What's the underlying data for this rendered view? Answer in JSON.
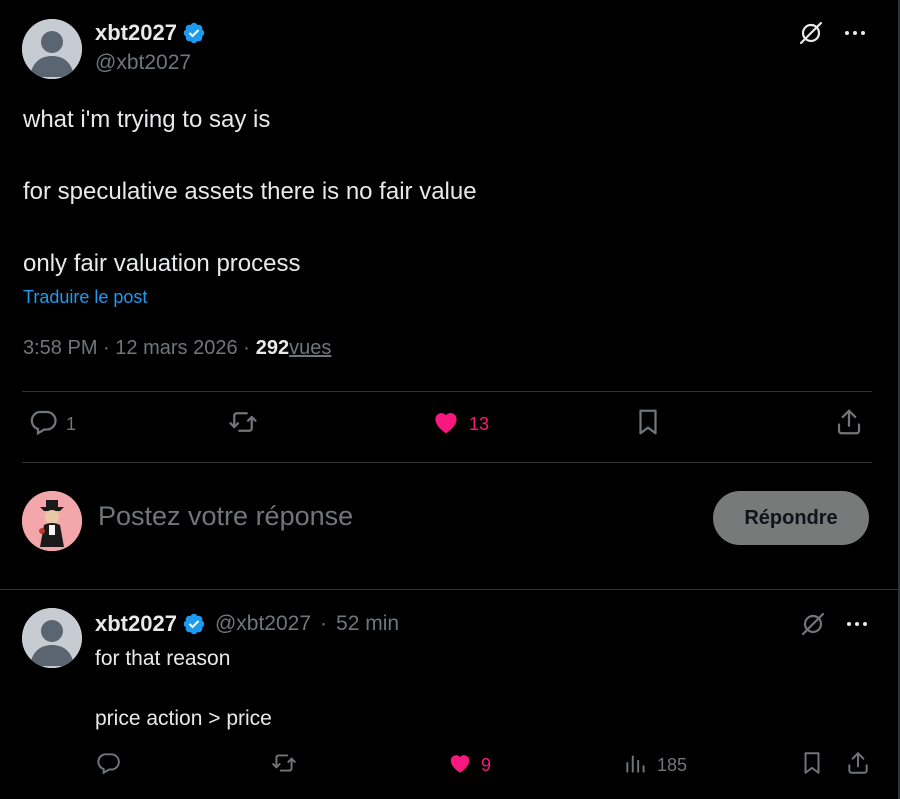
{
  "tweet": {
    "author_name": "xbt2027",
    "author_handle": "@xbt2027",
    "text": {
      "line1": "what i'm trying to say is",
      "line2": "for speculative assets there is no fair value",
      "line3": "only fair valuation process"
    },
    "translate_label": "Traduire le post",
    "time": "3:58 PM",
    "date": "12 mars 2026",
    "views_count": "292",
    "views_label": " vues",
    "replies": "1",
    "reposts": "",
    "likes": "13"
  },
  "composer": {
    "placeholder": "Postez votre réponse",
    "reply_button": "Répondre"
  },
  "reply": {
    "author_name": "xbt2027",
    "author_handle": "@xbt2027",
    "time_ago": "52 min",
    "text": {
      "line1": "for that reason",
      "line2": "price action > price"
    },
    "replies": "",
    "reposts": "",
    "likes": "9",
    "views": "185"
  },
  "colors": {
    "background": "#000000",
    "text": "#e7e9ea",
    "muted": "#71767b",
    "link": "#1d9bf0",
    "like": "#f91880",
    "verified": "#1d9bf0"
  },
  "icons": [
    "verified-badge-icon",
    "grok-icon",
    "more-icon",
    "reply-icon",
    "repost-icon",
    "heart-icon",
    "bookmark-icon",
    "share-icon",
    "views-icon"
  ]
}
